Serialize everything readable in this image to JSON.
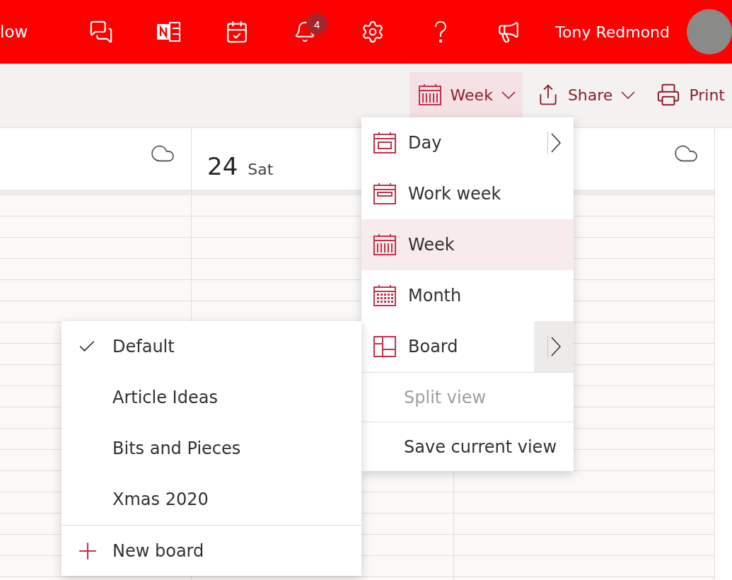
{
  "top_bar": {
    "app_title": "low",
    "notification_count": "4",
    "user_name": "Tony Redmond"
  },
  "toolbar": {
    "buttons": [
      {
        "kind": "view",
        "label": "Week",
        "expanded": true
      },
      {
        "kind": "share",
        "label": "Share",
        "expanded": false
      },
      {
        "kind": "print",
        "label": "Print",
        "expanded": false
      }
    ]
  },
  "calendar": {
    "days": [
      {
        "weather": true
      },
      {
        "number": "24",
        "weekday": "Sat"
      },
      {
        "weather": true
      }
    ]
  },
  "view_menu": {
    "items": [
      {
        "kind": "day",
        "label": "Day",
        "selected": false,
        "submenu": true,
        "submenu_open": false
      },
      {
        "kind": "workweek",
        "label": "Work week",
        "selected": false,
        "submenu": false
      },
      {
        "kind": "week",
        "label": "Week",
        "selected": true,
        "submenu": false
      },
      {
        "kind": "month",
        "label": "Month",
        "selected": false,
        "submenu": false
      },
      {
        "kind": "board",
        "label": "Board",
        "selected": false,
        "submenu": true,
        "submenu_open": true
      }
    ],
    "actions": [
      {
        "label": "Split view",
        "disabled": true
      },
      {
        "label": "Save current view",
        "disabled": false
      }
    ]
  },
  "board_menu": {
    "items": [
      {
        "label": "Default",
        "checked": true
      },
      {
        "label": "Article Ideas",
        "checked": false
      },
      {
        "label": "Bits and Pieces",
        "checked": false
      },
      {
        "label": "Xmas 2020",
        "checked": false
      }
    ],
    "new_item": "New board"
  }
}
